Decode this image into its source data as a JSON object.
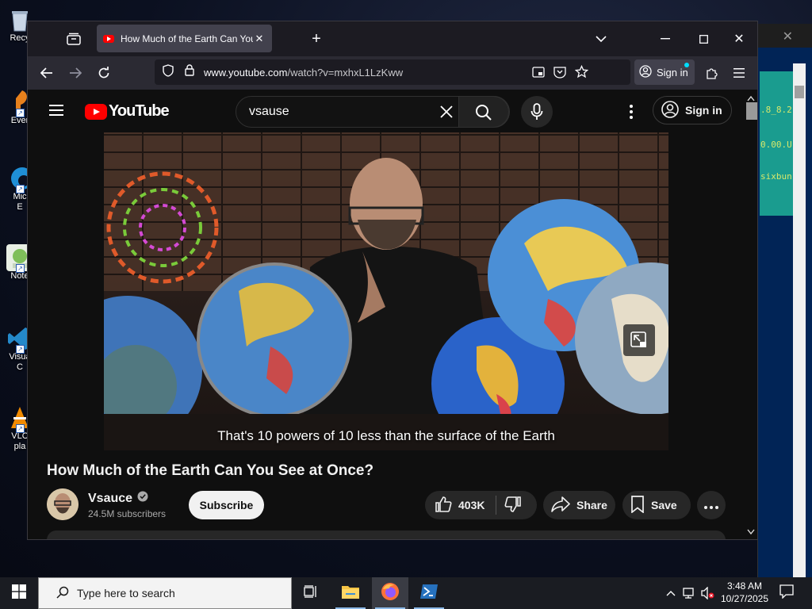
{
  "desktop": {
    "icons": [
      {
        "label": "Recy",
        "name": "recycle-bin"
      },
      {
        "label": "Ever",
        "name": "evernote"
      },
      {
        "label": "Mic",
        "label2": "E",
        "name": "microsoft-edge"
      },
      {
        "label": "Note",
        "name": "notepad-plus"
      },
      {
        "label": "Visua",
        "label2": "C",
        "name": "visual-studio-code"
      },
      {
        "label": "VLC",
        "label2": "pla",
        "name": "vlc-player"
      }
    ],
    "terminal_lines": [
      ".8_8.2",
      "0.00.U",
      "sixbun"
    ]
  },
  "firefox": {
    "tab_title": "How Much of the Earth Can You See at Once? - YouTube",
    "url_host": "www.youtube.com",
    "url_path": "/watch?v=mxhxL1LzKww",
    "signin_label": "Sign in"
  },
  "youtube": {
    "logo_text": "YouTube",
    "search_value": "vsause",
    "signin_label": "Sign in",
    "caption": "That's 10 powers of 10 less than the surface of the Earth",
    "video_title": "How Much of the Earth Can You See at Once?",
    "channel_name": "Vsauce",
    "subscribers": "24.5M subscribers",
    "subscribe_label": "Subscribe",
    "like_count": "403K",
    "share_label": "Share",
    "save_label": "Save"
  },
  "taskbar": {
    "search_placeholder": "Type here to search",
    "time": "3:48 AM",
    "date": "10/27/2025"
  },
  "colors": {
    "yt_bg": "#0f0f0f",
    "yt_red": "#ff0000",
    "firefox_toolbar": "#2b2a33",
    "firefox_tabbar": "#1c1b22"
  }
}
